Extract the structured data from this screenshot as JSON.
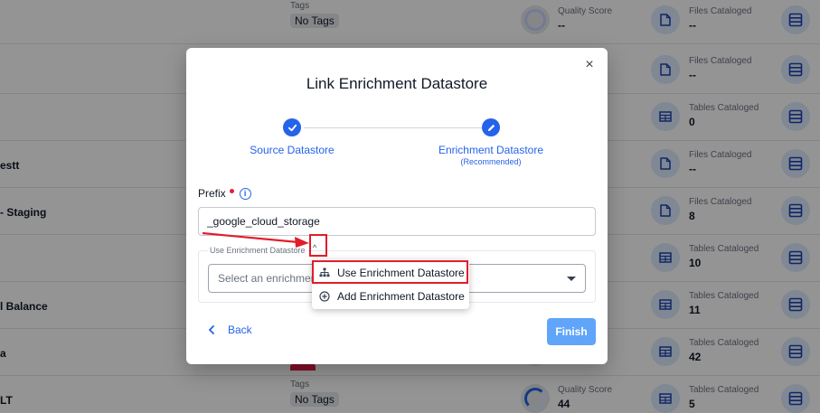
{
  "background": {
    "rows": [
      {
        "name": "",
        "tags_label": "Tags",
        "tags_value": "No Tags",
        "quality_label": "Quality Score",
        "quality_value": "--",
        "quality_ring": "empty",
        "cat_label": "Files Cataloged",
        "cat_value": "--",
        "cat_icon": "file-icon"
      },
      {
        "name": "",
        "tags_label": "",
        "tags_value": "",
        "quality_label": "",
        "quality_value": "",
        "quality_ring": "empty",
        "cat_label": "Files Cataloged",
        "cat_value": "--",
        "cat_icon": "file-icon"
      },
      {
        "name": "",
        "tags_label": "",
        "tags_value": "",
        "quality_label": "",
        "quality_value": "",
        "quality_ring": "empty",
        "cat_label": "Tables Cataloged",
        "cat_value": "0",
        "cat_icon": "table-icon"
      },
      {
        "name": "estt",
        "tags_label": "",
        "tags_value": "",
        "quality_label": "",
        "quality_value": "",
        "quality_ring": "empty",
        "cat_label": "Files Cataloged",
        "cat_value": "--",
        "cat_icon": "file-icon"
      },
      {
        "name": "- Staging",
        "tags_label": "",
        "tags_value": "",
        "quality_label": "",
        "quality_value": "",
        "quality_ring": "empty",
        "cat_label": "Files Cataloged",
        "cat_value": "8",
        "cat_icon": "file-icon"
      },
      {
        "name": "",
        "tags_label": "",
        "tags_value": "",
        "quality_label": "",
        "quality_value": "",
        "quality_ring": "empty",
        "cat_label": "Tables Cataloged",
        "cat_value": "10",
        "cat_icon": "table-icon"
      },
      {
        "name": "l Balance",
        "tags_label": "",
        "tags_value": "",
        "quality_label": "",
        "quality_value": "",
        "quality_ring": "empty",
        "cat_label": "Tables Cataloged",
        "cat_value": "11",
        "cat_icon": "table-icon"
      },
      {
        "name": "a",
        "tags_label": "",
        "tags_value": "",
        "quality_label": "",
        "quality_value": "",
        "quality_ring": "empty",
        "cat_label": "Tables Cataloged",
        "cat_value": "42",
        "cat_icon": "table-icon"
      },
      {
        "name": "LT",
        "tags_label": "Tags",
        "tags_value": "No Tags",
        "quality_label": "Quality Score",
        "quality_value": "44",
        "quality_ring": "partial",
        "cat_label": "Tables Cataloged",
        "cat_value": "5",
        "cat_icon": "table-icon"
      }
    ]
  },
  "modal": {
    "title": "Link Enrichment Datastore",
    "close_label": "×",
    "steps": [
      {
        "label": "Source Datastore",
        "icon": "check-icon"
      },
      {
        "label": "Enrichment Datastore",
        "sub": "(Recommended)",
        "icon": "pencil-icon"
      }
    ],
    "prefix": {
      "label": "Prefix",
      "info_icon": "i",
      "value": "_google_cloud_storage"
    },
    "enrichment": {
      "legend": "Use Enrichment Datastore",
      "select_placeholder": "Select an enrichment datastore",
      "menu": [
        {
          "label": "Use Enrichment Datastore",
          "icon": "hierarchy-icon"
        },
        {
          "label": "Add Enrichment Datastore",
          "icon": "plus-circle-icon"
        }
      ]
    },
    "back_label": "Back",
    "finish_label": "Finish"
  },
  "colors": {
    "primary": "#2563eb",
    "finish": "#60a5fa",
    "annotation": "#e11d2a",
    "required": "#e11d48"
  }
}
